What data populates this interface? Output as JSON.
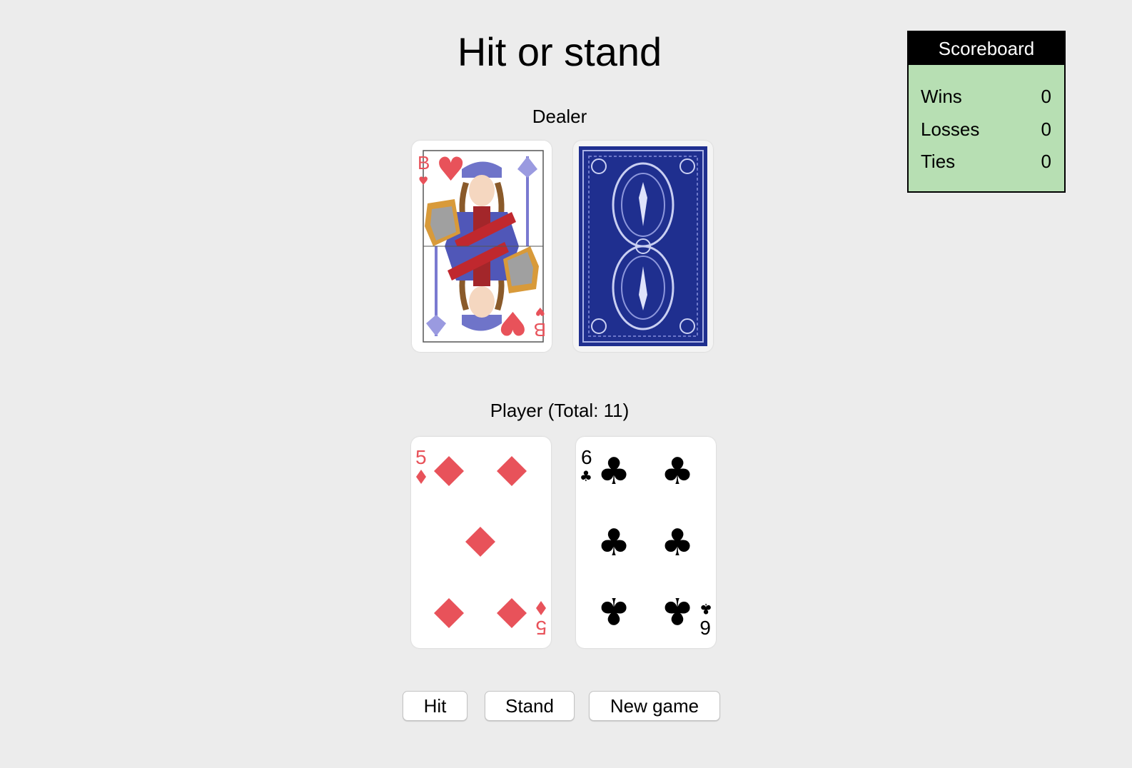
{
  "title": "Hit or stand",
  "dealer": {
    "label": "Dealer",
    "cards": [
      {
        "rank": "B",
        "suit": "hearts",
        "face_up": true
      },
      {
        "face_up": false,
        "back_color": "#1f2f8f"
      }
    ]
  },
  "player": {
    "label": "Player (Total: 11)",
    "cards": [
      {
        "rank": "5",
        "suit": "diamonds",
        "face_up": true
      },
      {
        "rank": "6",
        "suit": "clubs",
        "face_up": true
      }
    ]
  },
  "controls": {
    "hit_label": "Hit",
    "stand_label": "Stand",
    "new_game_label": "New game"
  },
  "scoreboard": {
    "title": "Scoreboard",
    "rows": [
      {
        "label": "Wins",
        "value": "0"
      },
      {
        "label": "Losses",
        "value": "0"
      },
      {
        "label": "Ties",
        "value": "0"
      }
    ]
  },
  "colors": {
    "background": "#ececec",
    "scoreboard_bg": "#b7dfb3",
    "red_suit": "#e8525a",
    "black_suit": "#000000",
    "card_back": "#1f2f8f"
  }
}
